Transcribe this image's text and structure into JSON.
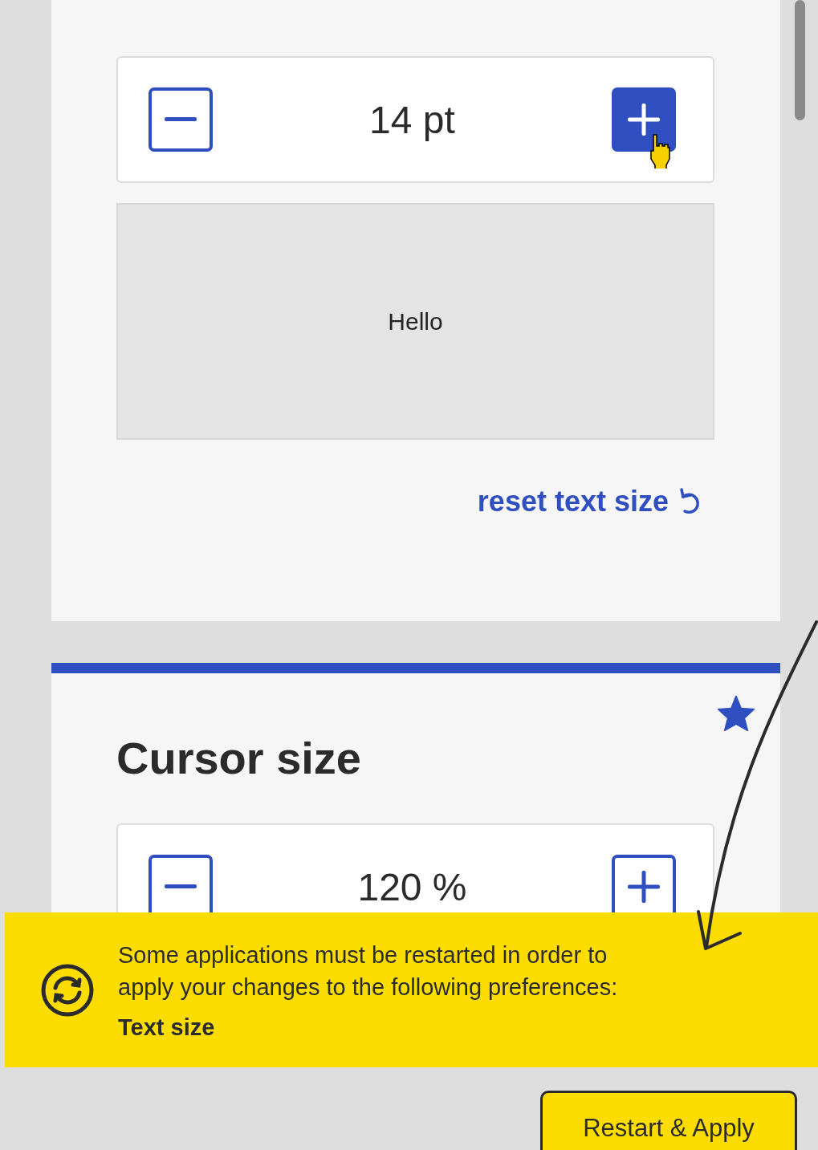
{
  "text_size": {
    "value": "14 pt",
    "increase_hovered": true,
    "preview": "Hello",
    "reset_link": "reset text size"
  },
  "cursor_size": {
    "title": "Cursor size",
    "starred": true,
    "value": "120 %",
    "increase_hovered": false
  },
  "restart_notice": {
    "message": "Some applications must be restarted in order to apply your changes to the following preferences:",
    "preferences": [
      "Text size"
    ]
  },
  "restart_button": "Restart & Apply"
}
